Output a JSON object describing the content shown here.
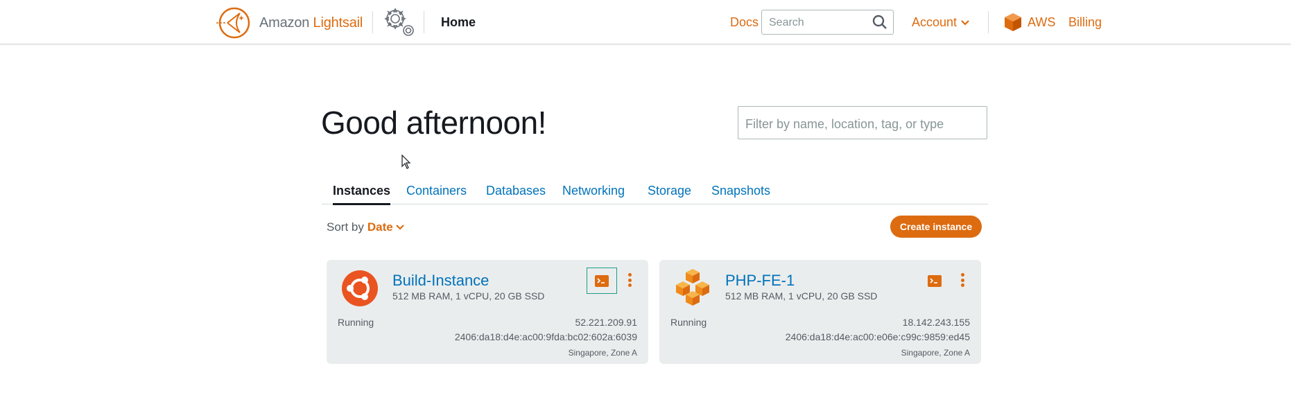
{
  "header": {
    "brand_amazon": "Amazon",
    "brand_product": "Lightsail",
    "home_label": "Home",
    "docs_label": "Docs",
    "search_placeholder": "Search",
    "account_label": "Account",
    "aws_label": "AWS",
    "billing_label": "Billing"
  },
  "main": {
    "greeting": "Good afternoon!",
    "filter_placeholder": "Filter by name, location, tag, or type",
    "tabs": [
      {
        "label": "Instances",
        "active": true
      },
      {
        "label": "Containers",
        "active": false
      },
      {
        "label": "Databases",
        "active": false
      },
      {
        "label": "Networking",
        "active": false
      },
      {
        "label": "Storage",
        "active": false
      },
      {
        "label": "Snapshots",
        "active": false
      }
    ],
    "sort_label": "Sort by",
    "sort_value": "Date",
    "create_button": "Create instance"
  },
  "instances": [
    {
      "name": "Build-Instance",
      "specs": "512 MB RAM, 1 vCPU, 20 GB SSD",
      "state": "Running",
      "ipv4": "52.221.209.91",
      "ipv6": "2406:da18:d4e:ac00:9fda:bc02:602a:6039",
      "zone": "Singapore, Zone A",
      "icon": "ubuntu-icon"
    },
    {
      "name": "PHP-FE-1",
      "specs": "512 MB RAM, 1 vCPU, 20 GB SSD",
      "state": "Running",
      "ipv4": "18.142.243.155",
      "ipv6": "2406:da18:d4e:ac00:e06e:c99c:9859:ed45",
      "zone": "Singapore, Zone A",
      "icon": "php-stack-icon"
    }
  ],
  "colors": {
    "accent": "#dd6b10",
    "link": "#0073bb",
    "card_bg": "#eaeded",
    "focus": "#1a9c8a"
  }
}
